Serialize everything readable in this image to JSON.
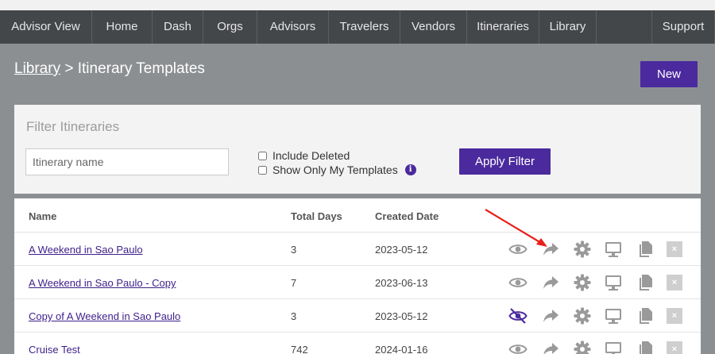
{
  "nav": {
    "items": [
      {
        "label": "Advisor View",
        "width": 116
      },
      {
        "label": "Home",
        "width": 76
      },
      {
        "label": "Dash",
        "width": 64
      },
      {
        "label": "Orgs",
        "width": 68
      },
      {
        "label": "Advisors",
        "width": 90
      },
      {
        "label": "Travelers",
        "width": 90
      },
      {
        "label": "Vendors",
        "width": 84
      },
      {
        "label": "Itineraries",
        "width": 91
      },
      {
        "label": "Library",
        "width": 72
      }
    ],
    "support": "Support"
  },
  "breadcrumb": {
    "parent": "Library",
    "separator": " > ",
    "current": "Itinerary Templates"
  },
  "new_button": "New",
  "filter": {
    "title": "Filter Itineraries",
    "name_placeholder": "Itinerary name",
    "include_deleted": "Include Deleted",
    "show_only_mine": "Show Only My Templates",
    "info": "i",
    "apply": "Apply Filter"
  },
  "table": {
    "headers": {
      "name": "Name",
      "days": "Total Days",
      "created": "Created Date"
    },
    "rows": [
      {
        "name": "A Weekend in Sao Paulo",
        "days": "3",
        "created": "2023-05-12",
        "visible": true
      },
      {
        "name": "A Weekend in Sao Paulo - Copy",
        "days": "7",
        "created": "2023-06-13",
        "visible": true
      },
      {
        "name": "Copy of A Weekend in Sao Paulo",
        "days": "3",
        "created": "2023-05-12",
        "visible": false
      },
      {
        "name": "Cruise Test",
        "days": "742",
        "created": "2024-01-16",
        "visible": true
      }
    ],
    "close_glyph": "×"
  },
  "colors": {
    "accent": "#4b2a9e",
    "nav_bg": "#44474a",
    "annotation": "#e8201a"
  }
}
